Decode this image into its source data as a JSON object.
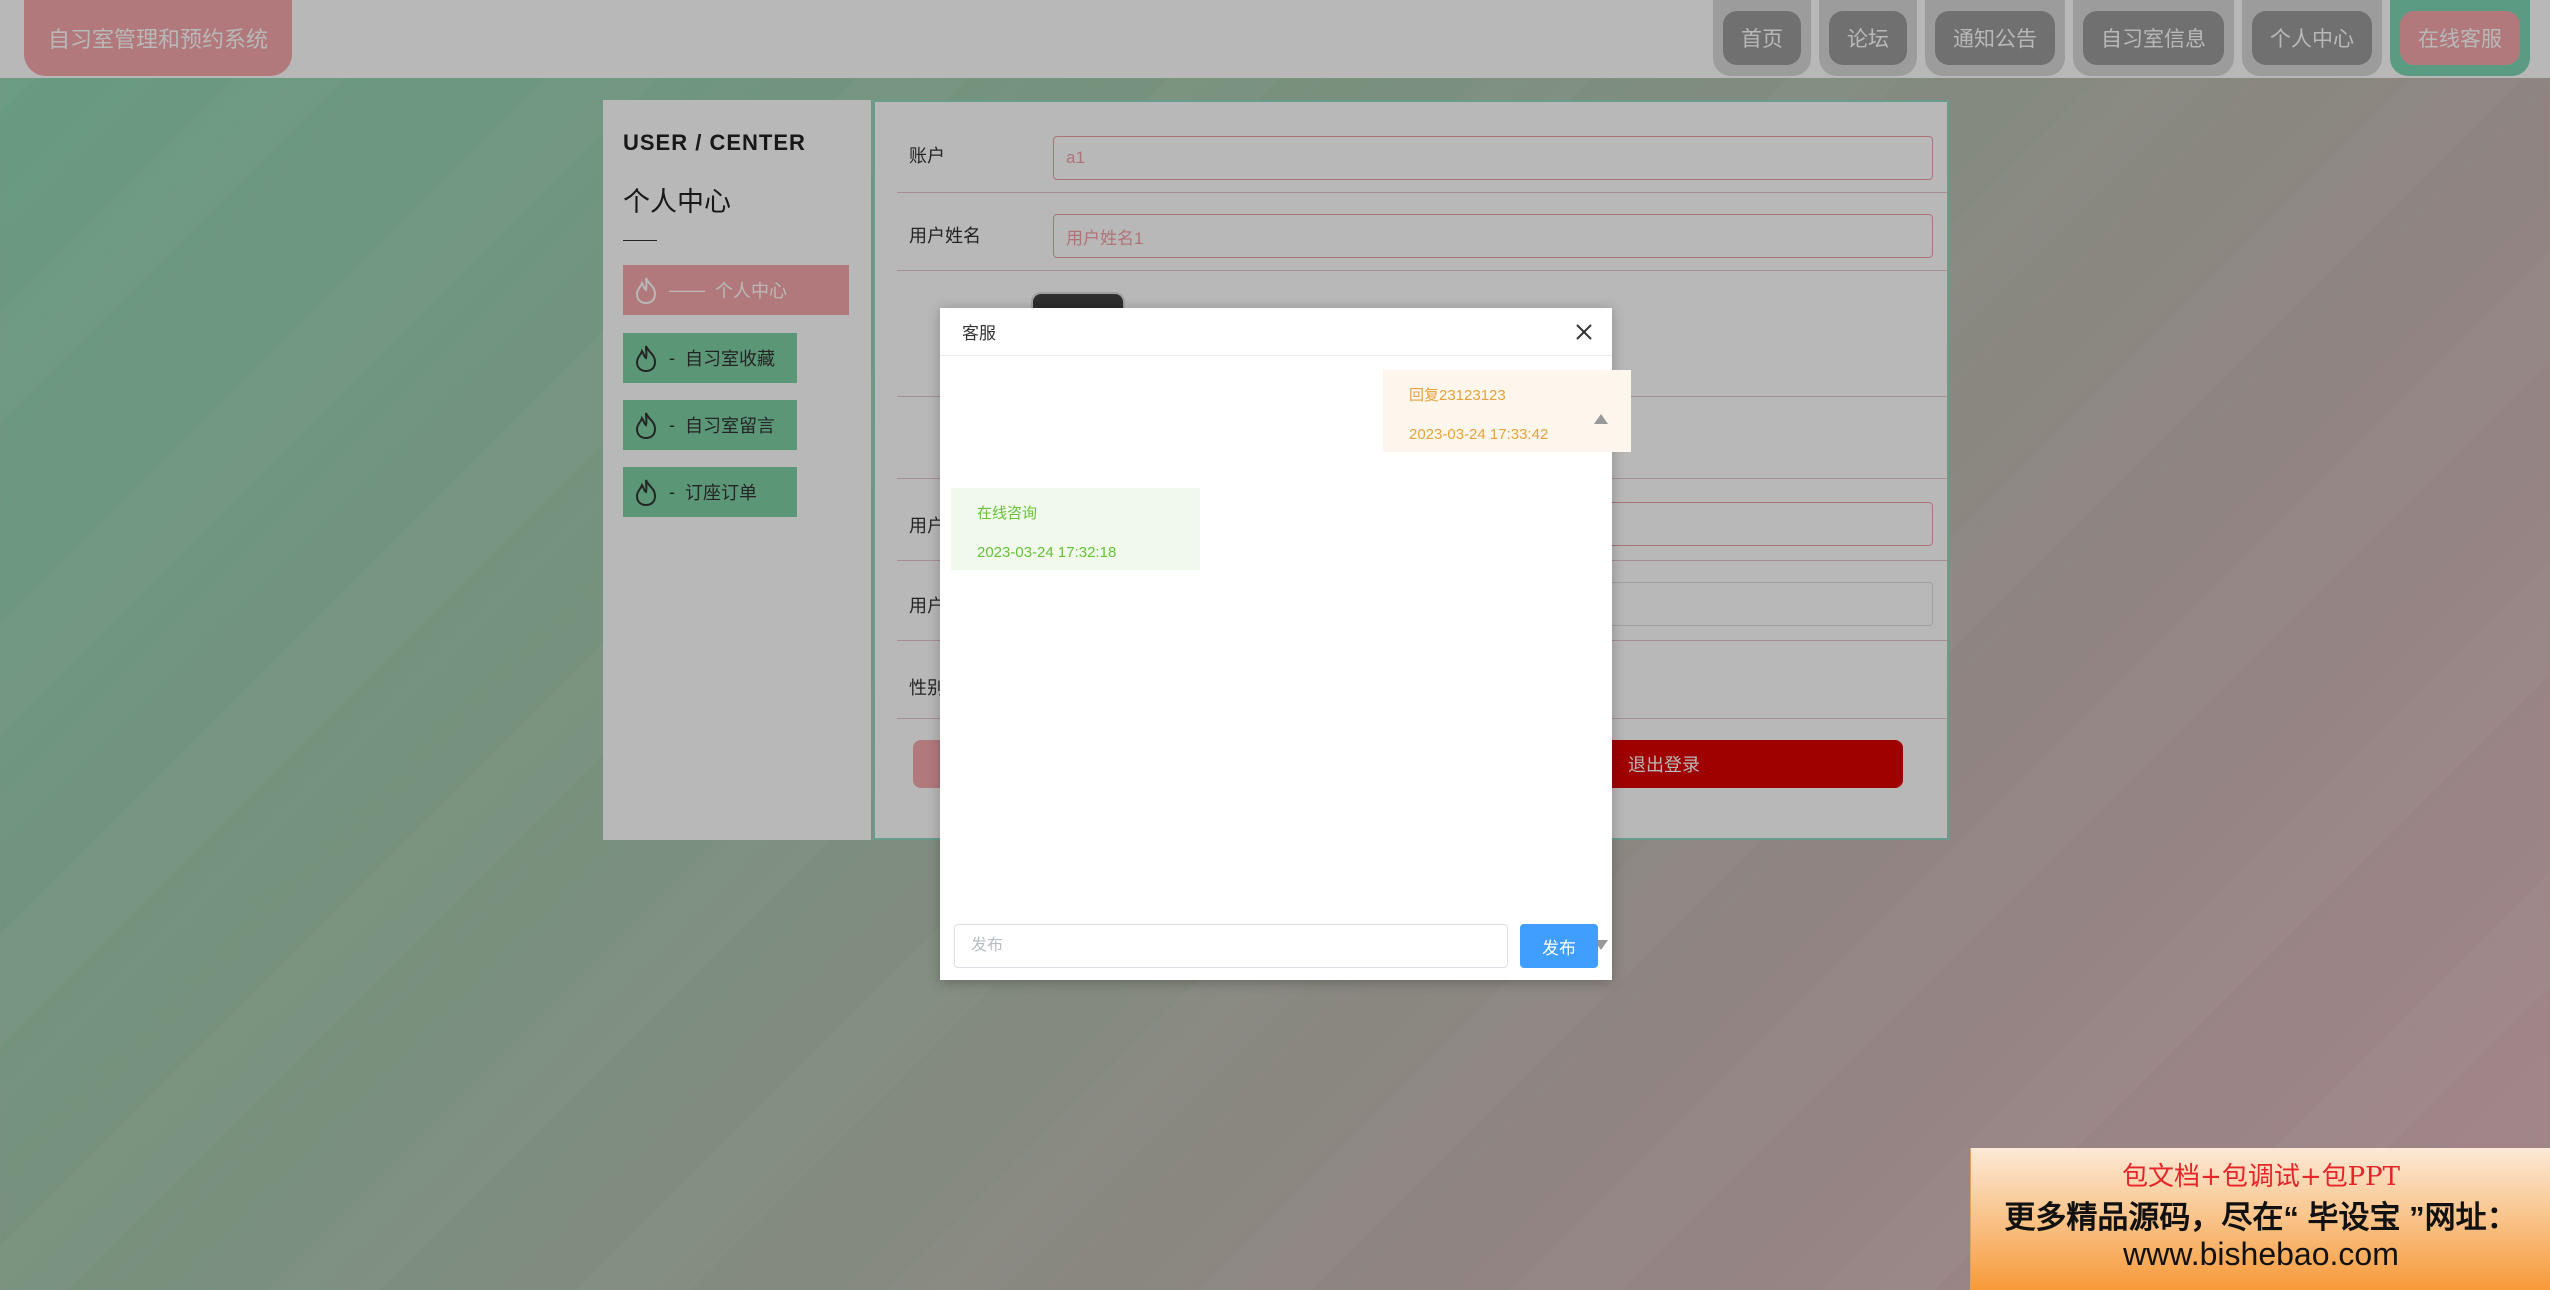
{
  "app": {
    "title": "自习室管理和预约系统"
  },
  "nav": {
    "items": [
      {
        "label": "首页"
      },
      {
        "label": "论坛"
      },
      {
        "label": "通知公告"
      },
      {
        "label": "自习室信息"
      },
      {
        "label": "个人中心"
      },
      {
        "label": "在线客服"
      }
    ],
    "active": "在线客服"
  },
  "sidebar": {
    "title_en": "USER / CENTER",
    "title_cn": "个人中心",
    "items": [
      {
        "sep": "——",
        "label": "个人中心"
      },
      {
        "sep": "-",
        "label": "自习室收藏"
      },
      {
        "sep": "-",
        "label": "自习室留言"
      },
      {
        "sep": "-",
        "label": "订座订单"
      }
    ]
  },
  "form": {
    "account_label": "账户",
    "account_value": "a1",
    "name_label": "用户姓名",
    "name_value": "用户姓名1",
    "user_label_1": "用户",
    "user_label_2": "用户",
    "gender_label": "性别",
    "logout_label": "退出登录"
  },
  "dialog": {
    "title": "客服",
    "messages": [
      {
        "side": "right",
        "text": "回复23123123",
        "time": "2023-03-24 17:33:42"
      },
      {
        "side": "left",
        "text": "在线咨询",
        "time": "2023-03-24 17:32:18"
      }
    ],
    "input_placeholder": "发布",
    "send_label": "发布"
  },
  "banner": {
    "line1": "包文档+包调试+包PPT",
    "line2": "更多精品源码，尽在“ 毕设宝 ”网址：",
    "line3": "www.bishebao.com"
  },
  "colors": {
    "brand": "#f7a8ad",
    "sidebar_item": "#7fd1a6",
    "logout": "#dd0000",
    "send": "#409eff"
  }
}
